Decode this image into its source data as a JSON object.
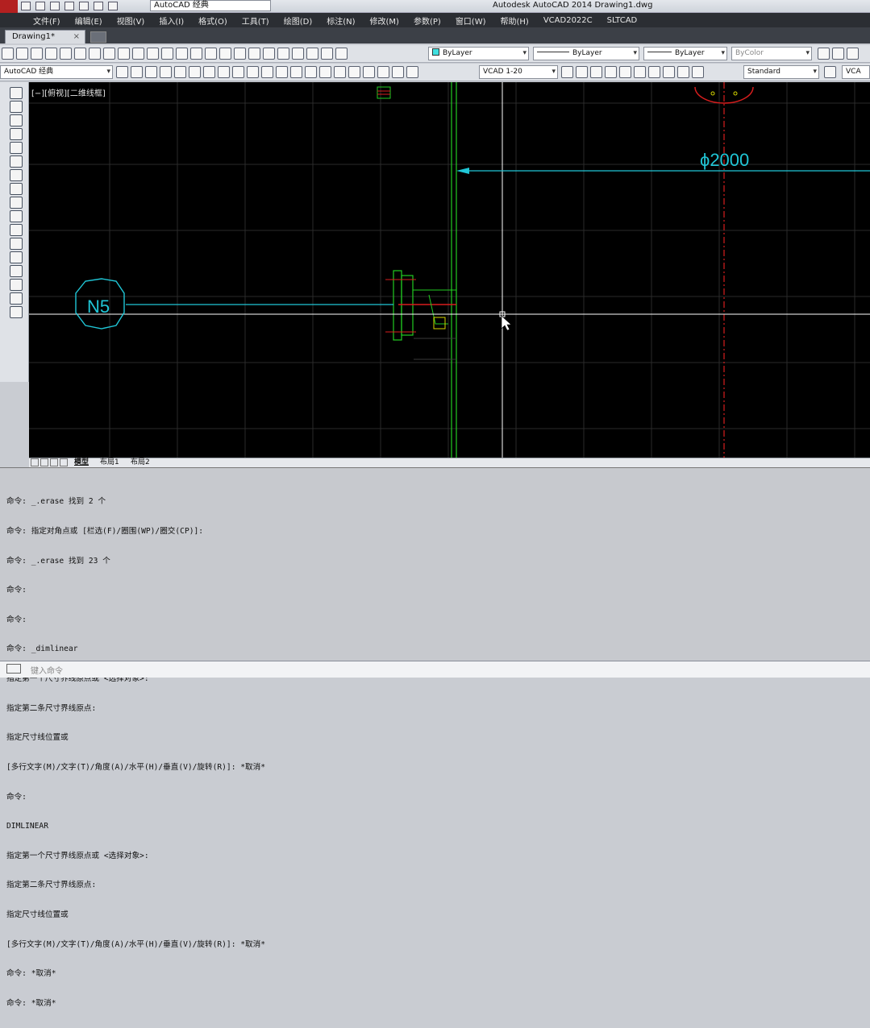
{
  "window": {
    "title": "Autodesk AutoCAD 2014    Drawing1.dwg",
    "workspace": "AutoCAD 经典"
  },
  "menu": [
    "文件(F)",
    "编辑(E)",
    "视图(V)",
    "插入(I)",
    "格式(O)",
    "工具(T)",
    "绘图(D)",
    "标注(N)",
    "修改(M)",
    "参数(P)",
    "窗口(W)",
    "帮助(H)",
    "VCAD2022C",
    "SLTCAD"
  ],
  "tab": {
    "doc": "Drawing1*",
    "close": "×"
  },
  "properties": {
    "layer": "ByLayer",
    "linetype": "ByLayer",
    "lineweight": "ByLayer",
    "plotstyle": "ByColor",
    "layer_color": "#40e0e0"
  },
  "toolbar2": {
    "workspace": "AutoCAD 经典",
    "scale": "VCAD 1-20",
    "text_style": "Standard",
    "right_label": "VCA"
  },
  "viewport": {
    "label": "[−][俯视][二维线框]",
    "dimension_text": "ϕ2000",
    "node_label": "N5"
  },
  "layout_tabs": [
    "模型",
    "布局1",
    "布局2"
  ],
  "command_history": [
    "命令: _.erase 找到 2 个",
    "命令: 指定对角点或 [栏选(F)/圈围(WP)/圈交(CP)]:",
    "命令: _.erase 找到 23 个",
    "命令:",
    "命令:",
    "命令: _dimlinear",
    "指定第一个尺寸界线原点或 <选择对象>:",
    "指定第二条尺寸界线原点:",
    "指定尺寸线位置或",
    "[多行文字(M)/文字(T)/角度(A)/水平(H)/垂直(V)/旋转(R)]: *取消*",
    "命令:",
    "DIMLINEAR",
    "指定第一个尺寸界线原点或 <选择对象>:",
    "指定第二条尺寸界线原点:",
    "指定尺寸线位置或",
    "[多行文字(M)/文字(T)/角度(A)/水平(H)/垂直(V)/旋转(R)]: *取消*",
    "命令: *取消*",
    "命令: *取消*"
  ],
  "command_prompt": "键入命令",
  "icons": [
    "save-icon",
    "open-icon",
    "print-icon",
    "undo-icon",
    "redo-icon",
    "pan-icon",
    "zoom-icon",
    "layer-icon",
    "line-icon",
    "circle-icon",
    "arc-icon",
    "move-icon",
    "copy-icon",
    "rotate-icon",
    "text-icon"
  ]
}
